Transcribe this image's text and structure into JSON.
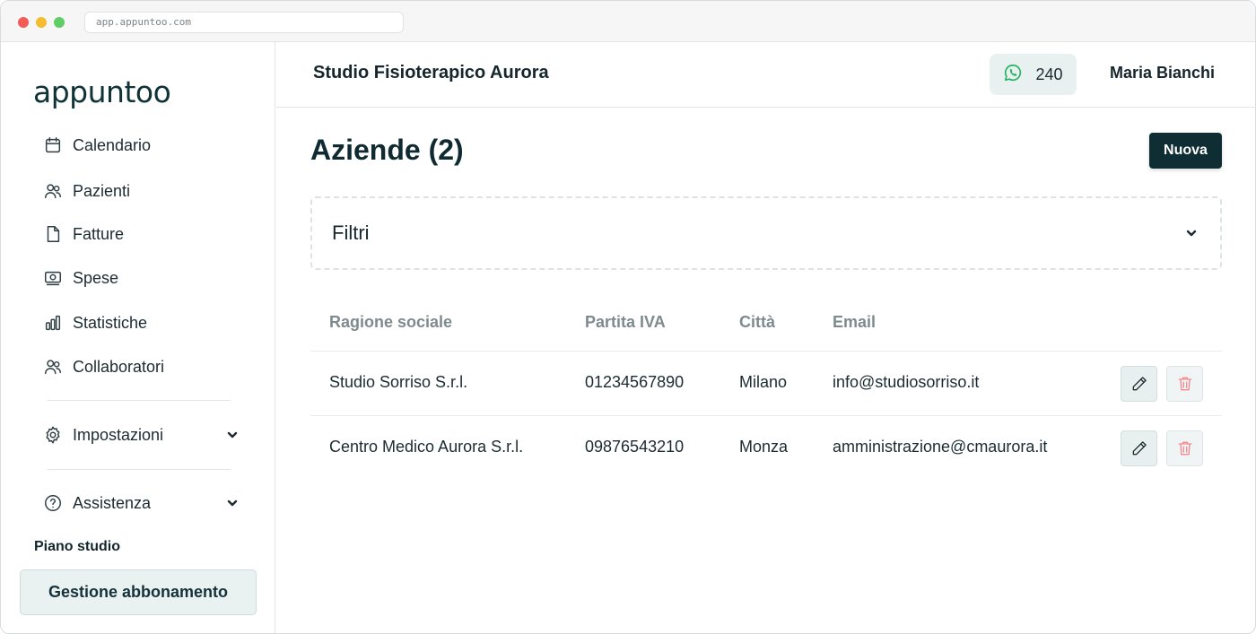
{
  "browser": {
    "url": "app.appuntoo.com"
  },
  "sidebar": {
    "logo": "appuntoo",
    "items": [
      {
        "label": "Calendario",
        "icon": "calendar-icon"
      },
      {
        "label": "Pazienti",
        "icon": "users-icon"
      },
      {
        "label": "Fatture",
        "icon": "document-icon"
      },
      {
        "label": "Spese",
        "icon": "banknote-icon"
      },
      {
        "label": "Statistiche",
        "icon": "bar-chart-icon"
      },
      {
        "label": "Collaboratori",
        "icon": "users-icon"
      }
    ],
    "settings": {
      "label": "Impostazioni",
      "icon": "gear-icon"
    },
    "support": {
      "label": "Assistenza",
      "icon": "help-circle-icon"
    },
    "plan_label": "Piano studio",
    "plan_button": "Gestione abbonamento"
  },
  "header": {
    "studio_name": "Studio Fisioterapico Aurora",
    "whatsapp_count": "240",
    "user_name": "Maria Bianchi"
  },
  "main": {
    "title": "Aziende (2)",
    "new_button": "Nuova",
    "filters_label": "Filtri",
    "columns": [
      "Ragione sociale",
      "Partita IVA",
      "Città",
      "Email"
    ],
    "rows": [
      {
        "name": "Studio Sorriso S.r.l.",
        "vat": "01234567890",
        "city": "Milano",
        "email": "info@studiosorriso.it"
      },
      {
        "name": "Centro Medico Aurora S.r.l.",
        "vat": "09876543210",
        "city": "Monza",
        "email": "amministrazione@cmaurora.it"
      }
    ]
  },
  "colors": {
    "primary": "#0f2e33",
    "accent_bg": "#e8f0f0",
    "whatsapp": "#25b262",
    "danger": "#ef8a8f"
  }
}
